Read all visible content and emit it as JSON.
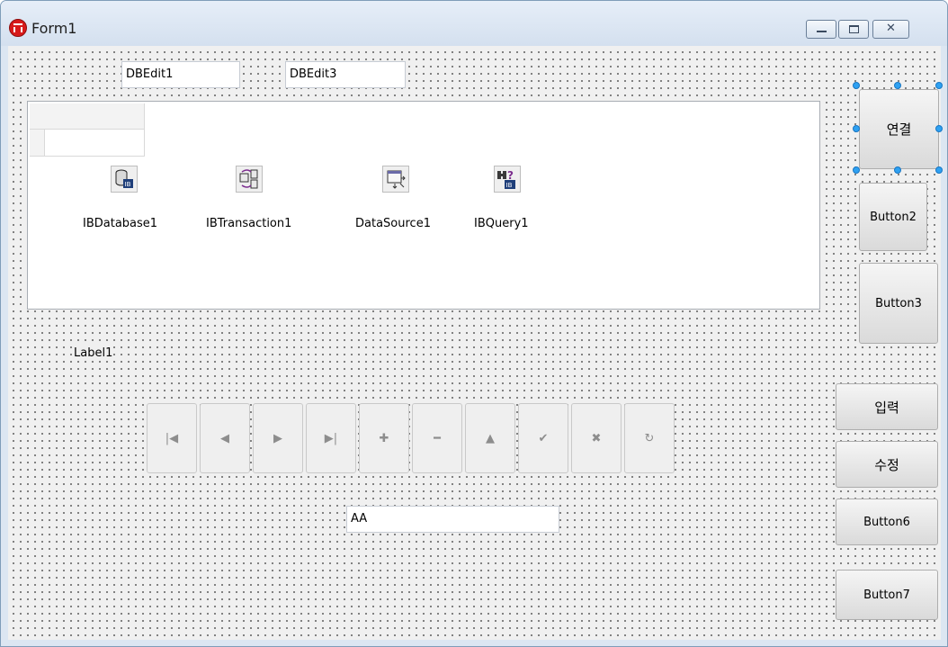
{
  "window": {
    "title": "Form1"
  },
  "edits": {
    "dbedit1": "DBEdit1",
    "dbedit3": "DBEdit3",
    "aa": "AA"
  },
  "components": [
    {
      "label": "IBDatabase1",
      "icon": "database-icon"
    },
    {
      "label": "IBTransaction1",
      "icon": "transaction-icon"
    },
    {
      "label": "DataSource1",
      "icon": "datasource-icon"
    },
    {
      "label": "IBQuery1",
      "icon": "query-icon"
    }
  ],
  "label1": "Label1",
  "buttons": {
    "connect": "연결",
    "button2": "Button2",
    "button3": "Button3",
    "input": "입력",
    "modify": "수정",
    "button6": "Button6",
    "button7": "Button7"
  },
  "navigator": {
    "glyphs": [
      "|◀",
      "◀",
      "▶",
      "▶|",
      "✚",
      "━",
      "▲",
      "✔",
      "✖",
      "↻"
    ],
    "names": [
      "first",
      "prior",
      "next",
      "last",
      "insert",
      "delete",
      "edit",
      "post",
      "cancel",
      "refresh"
    ]
  },
  "colors": {
    "selection": "#2ea1f2",
    "titlebar": "#d4e0ef",
    "form": "#f0f0f0"
  }
}
